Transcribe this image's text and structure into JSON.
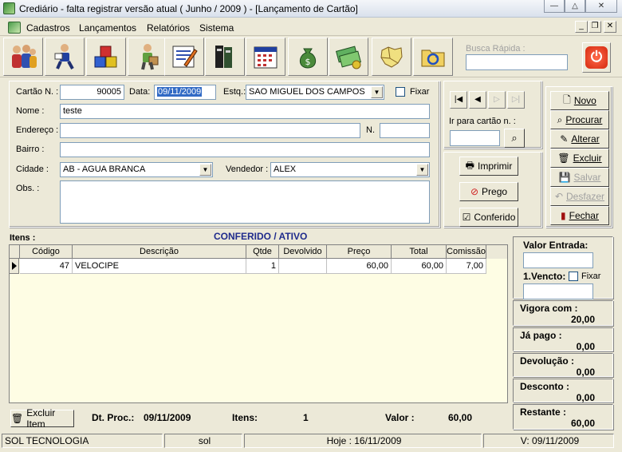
{
  "window": {
    "title": "Crediário - falta registrar versão atual ( Junho / 2009 ) - [Lançamento de Cartão]",
    "minimize": "—",
    "restore": "△",
    "close": "✕"
  },
  "menu": {
    "items": [
      "Cadastros",
      "Lançamentos",
      "Relatórios",
      "Sistema"
    ],
    "mdi_min": "_",
    "mdi_restore": "❐",
    "mdi_close": "✕"
  },
  "toolbar": {
    "icons": [
      "people-icon",
      "courier-icon",
      "cubes-icon",
      "worker-icon",
      "pen-paper-icon",
      "books-icon",
      "calendar-icon",
      "money-bag-icon",
      "cash-icon",
      "map-icon",
      "folder-sync-icon"
    ],
    "busca_label": "Busca Rápida :",
    "busca_value": "",
    "power_symbol": "⏻"
  },
  "form": {
    "cartao_label": "Cartão N. :",
    "cartao_value": "90005",
    "data_label": "Data:",
    "data_value": "09/11/2009",
    "estq_label": "Estq.:",
    "estq_value": "SAO MIGUEL DOS CAMPOS",
    "fixar_label": "Fixar",
    "nome_label": "Nome :",
    "nome_value": "teste",
    "endereco_label": "Endereço :",
    "endereco_value": "",
    "numero_label": "N.",
    "numero_value": "",
    "bairro_label": "Bairro :",
    "bairro_value": "",
    "cidade_label": "Cidade :",
    "cidade_value": "AB - AGUA BRANCA",
    "vendedor_label": "Vendedor :",
    "vendedor_value": "ALEX",
    "obs_label": "Obs. :",
    "obs_value": ""
  },
  "nav": {
    "first": "|◀",
    "prev": "◀",
    "next": "▷",
    "last": "▷|",
    "ir_label": "Ir para cartão n. :",
    "ir_value": ""
  },
  "mid_actions": {
    "imprimir": "Imprimir",
    "prego": "Prego",
    "conferido": "Conferido"
  },
  "actions": {
    "novo": "Novo",
    "procurar": "Procurar",
    "alterar": "Alterar",
    "excluir": "Excluir",
    "salvar": "Salvar",
    "desfazer": "Desfazer",
    "fechar": "Fechar"
  },
  "itens": {
    "label": "Itens :",
    "status": "CONFERIDO / ATIVO",
    "columns": [
      "Código",
      "Descrição",
      "Qtde",
      "Devolvido",
      "Preço",
      "Total",
      "Comissão"
    ],
    "rows": [
      {
        "codigo": "47",
        "descricao": "VELOCIPE",
        "qtde": "1",
        "devolvido": "",
        "preco": "60,00",
        "total": "60,00",
        "comissao": "7,00"
      }
    ]
  },
  "summary": {
    "valor_entrada_label": "Valor Entrada:",
    "valor_entrada_value": "",
    "vencto_label": "1.Vencto:",
    "vencto_fixar": "Fixar",
    "vencto_value": "",
    "vigora_label": "Vigora com :",
    "vigora_value": "20,00",
    "ja_pago_label": "Já pago :",
    "ja_pago_value": "0,00",
    "devolucao_label": "Devolução :",
    "devolucao_value": "0,00",
    "desconto_label": "Desconto :",
    "desconto_value": "0,00",
    "restante_label": "Restante :",
    "restante_value": "60,00"
  },
  "bottom": {
    "excluir_item": "Excluir Item",
    "dt_proc_label": "Dt. Proc.:",
    "dt_proc_value": "09/11/2009",
    "itens_label": "Itens:",
    "itens_value": "1",
    "valor_label": "Valor :",
    "valor_value": "60,00"
  },
  "statusbar": {
    "company": "SOL TECNOLOGIA",
    "user": "sol",
    "hoje": "Hoje : 16/11/2009",
    "versao": "V: 09/11/2009"
  }
}
